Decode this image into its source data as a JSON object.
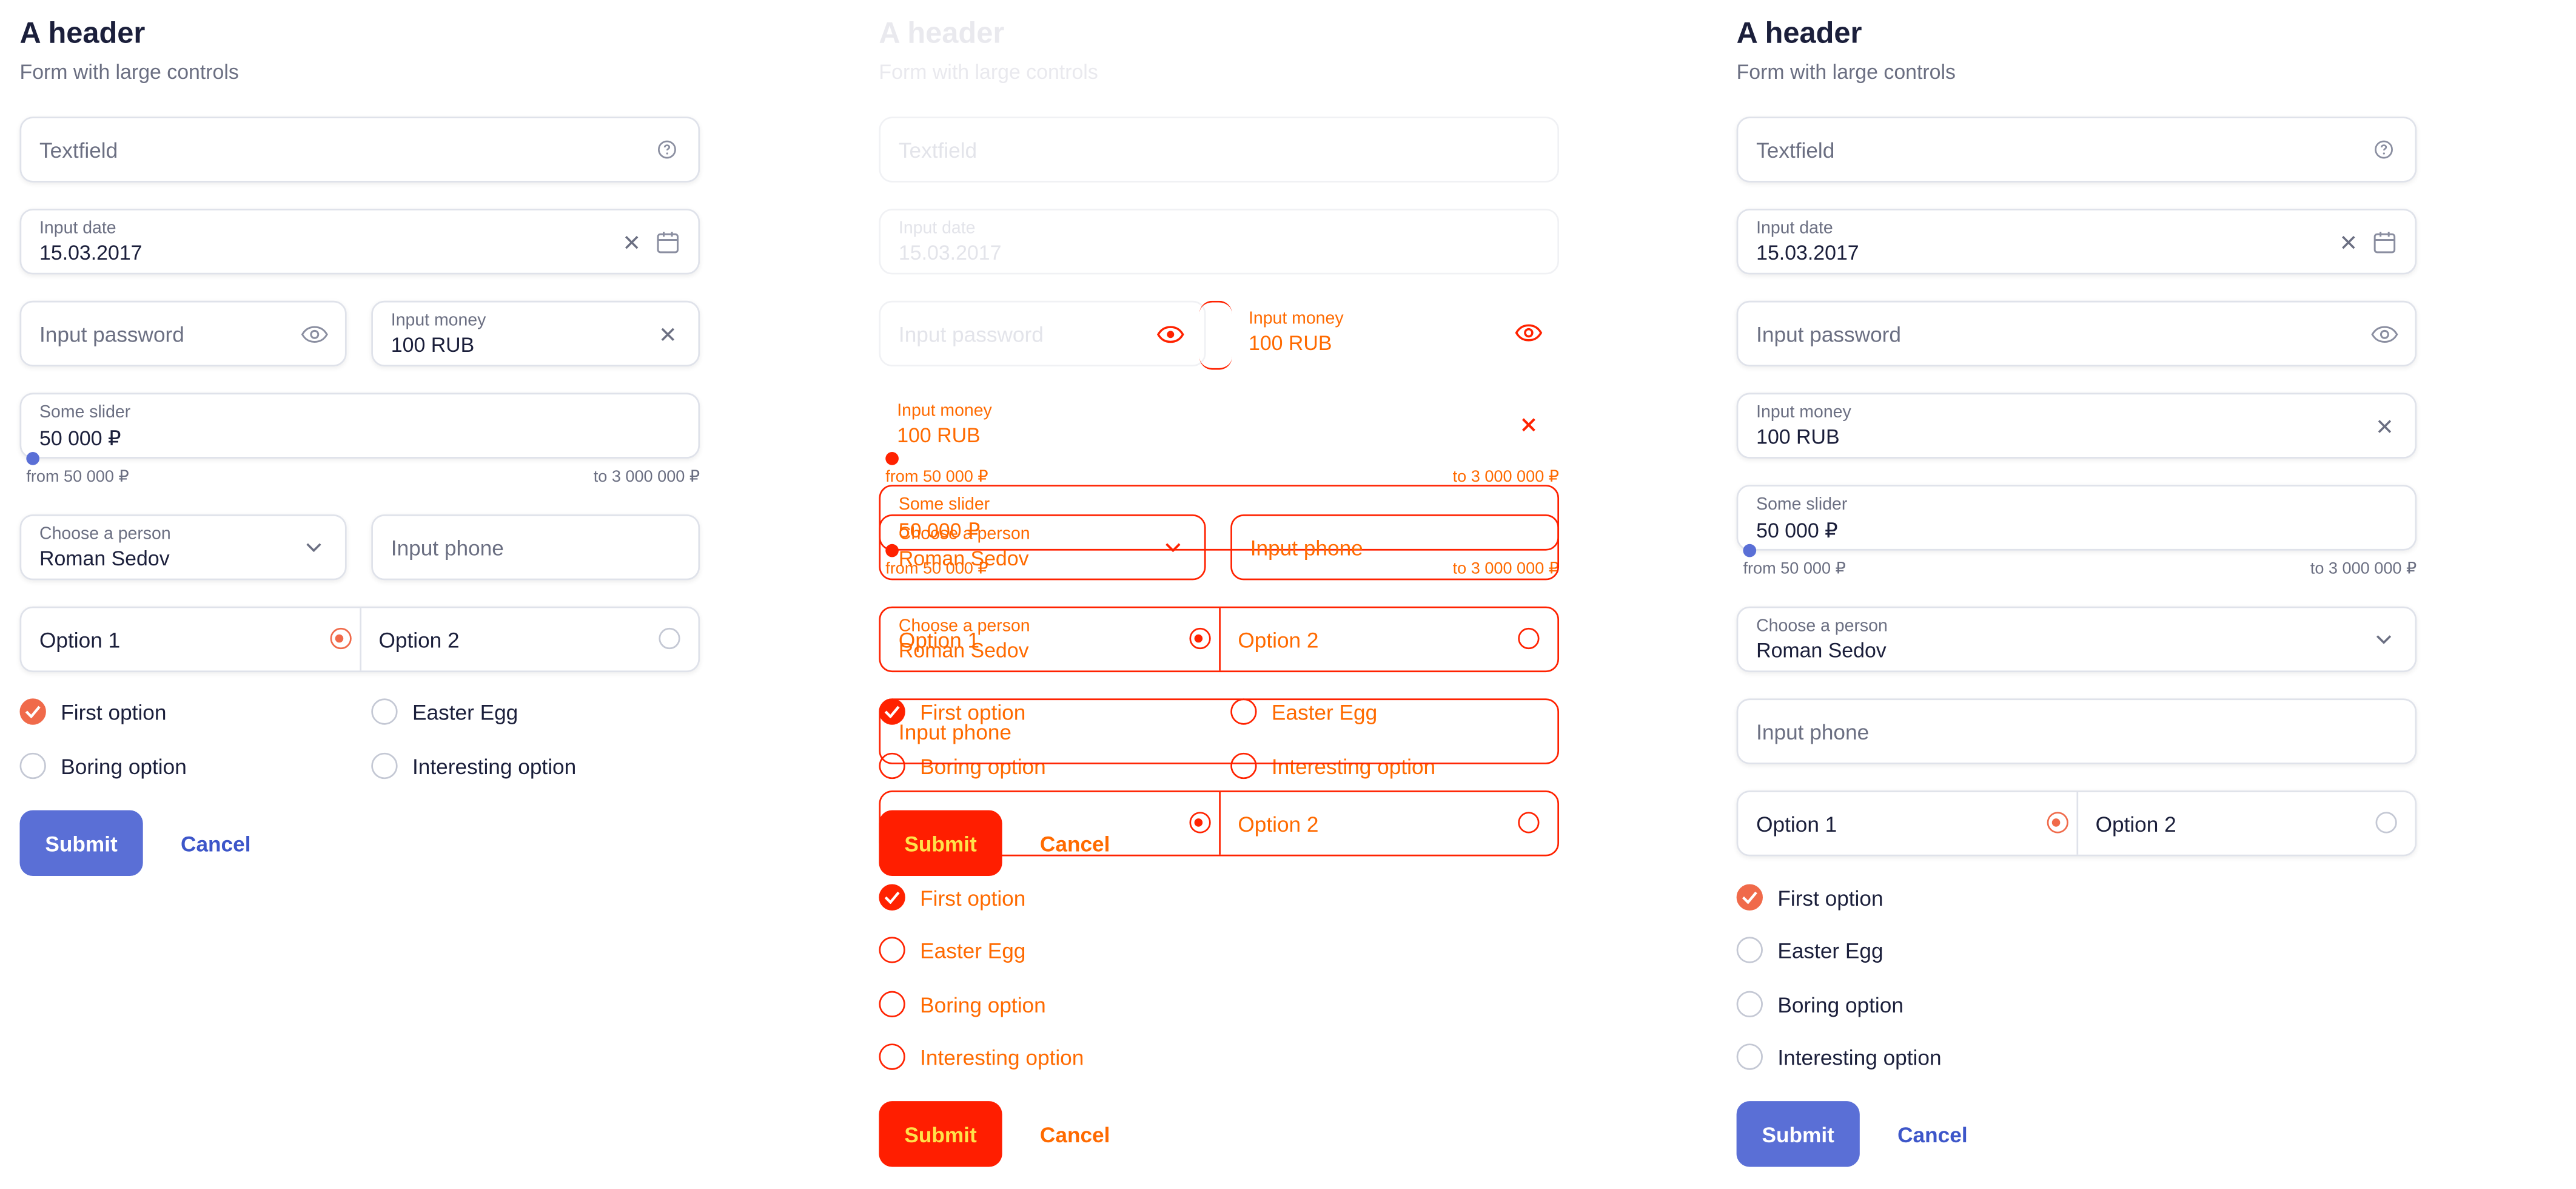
{
  "header": {
    "title": "A header",
    "subtitle": "Form with large controls"
  },
  "form": {
    "textfield_placeholder": "Textfield",
    "date_label": "Input date",
    "date_value": "15.03.2017",
    "password_placeholder": "Input password",
    "money_label": "Input money",
    "money_value": "100 RUB",
    "slider_label": "Some slider",
    "slider_value": "50 000 ₽",
    "slider_min_text": "from 50 000 ₽",
    "slider_max_text": "to 3 000 000 ₽",
    "slider_fraction": 0,
    "person_label": "Choose a person",
    "person_value": "Roman Sedov",
    "phone_placeholder": "Input phone",
    "radio_options": [
      "Option 1",
      "Option 2"
    ],
    "radio_selected": "Option 1",
    "checkboxes": [
      {
        "label": "First option",
        "checked": true
      },
      {
        "label": "Easter Egg",
        "checked": false
      },
      {
        "label": "Boring option",
        "checked": false
      },
      {
        "label": "Interesting option",
        "checked": false
      }
    ],
    "submit_label": "Submit",
    "cancel_label": "Cancel"
  },
  "icons": {
    "help": "help-circle-icon",
    "clear": "close-icon",
    "calendar": "calendar-icon",
    "eye": "eye-icon",
    "chevron": "chevron-down-icon",
    "check": "check-icon"
  },
  "colors": {
    "accent": "#5a6fd6",
    "link": "#3d56c9",
    "check": "#f06a4a",
    "debug_outline": "#ff2200",
    "debug_text": "#ff6a00",
    "debug_button": "#ff1e00",
    "debug_button_text": "#ffe24a"
  }
}
